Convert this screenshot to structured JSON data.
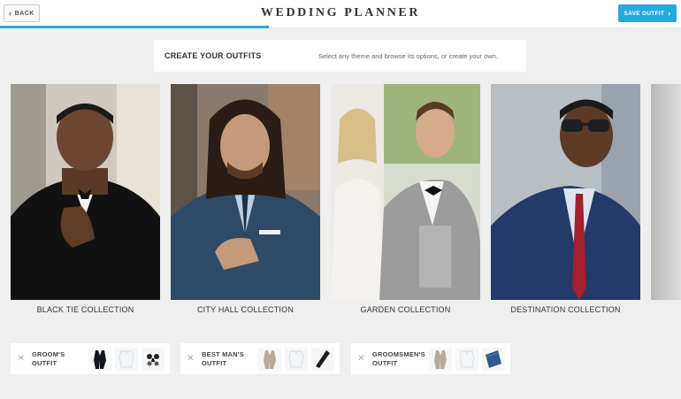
{
  "header": {
    "back_label": "BACK",
    "title": "WEDDING PLANNER",
    "save_label": "SAVE OUTFIT"
  },
  "intro": {
    "heading": "CREATE YOUR OUTFITS",
    "hint": "Select any theme and browse its options, or create your own."
  },
  "collections": [
    {
      "label": "BLACK TIE COLLECTION"
    },
    {
      "label": "CITY HALL COLLECTION"
    },
    {
      "label": "GARDEN COLLECTION"
    },
    {
      "label": "DESTINATION COLLECTION"
    }
  ],
  "outfits": [
    {
      "label_line1": "GROOM'S",
      "label_line2": "OUTFIT"
    },
    {
      "label_line1": "BEST MAN'S",
      "label_line2": "OUTFIT"
    },
    {
      "label_line1": "GROOMSMEN'S",
      "label_line2": "OUTFIT"
    }
  ],
  "colors": {
    "accent": "#2aa8de",
    "background": "#efefef"
  }
}
